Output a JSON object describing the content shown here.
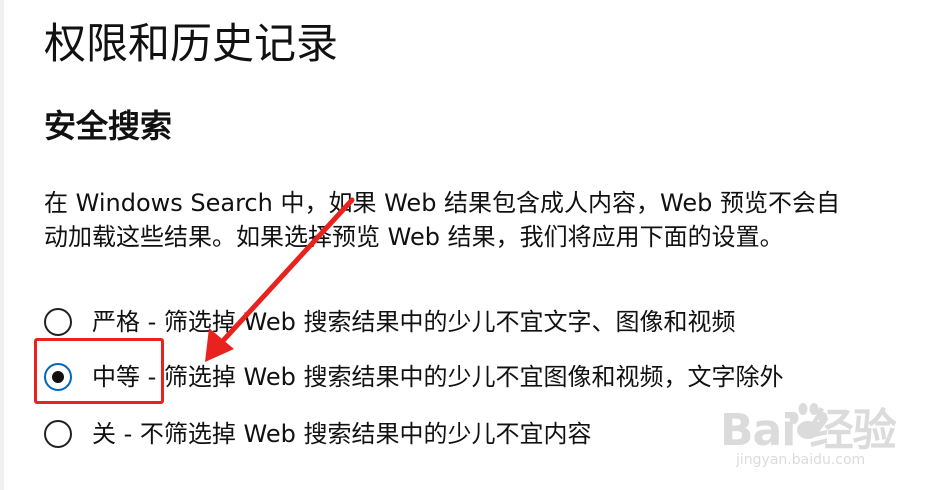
{
  "page": {
    "title": "权限和历史记录"
  },
  "safe_search": {
    "heading": "安全搜索",
    "description_lines": [
      "在 Windows Search 中，如果 Web 结果包含成人内容，Web 预览不会自",
      "动加载这些结果。如果选择预览 Web 结果，我们将应用下面的设置。"
    ],
    "options": [
      {
        "label": "严格 - 筛选掉 Web 搜索结果中的少儿不宜文字、图像和视频",
        "selected": false
      },
      {
        "label": "中等 - 筛选掉 Web 搜索结果中的少儿不宜图像和视频，文字除外",
        "selected": true
      },
      {
        "label": "关 - 不筛选掉 Web 搜索结果中的少儿不宜内容",
        "selected": false
      }
    ]
  },
  "annotation": {
    "color": "#e8231f"
  },
  "watermark": {
    "brand": "Bai  经验",
    "url": "jingyan.baidu.com"
  },
  "colors": {
    "accent": "#0067c0",
    "text": "#111111",
    "annotation_red": "#e8231f"
  }
}
